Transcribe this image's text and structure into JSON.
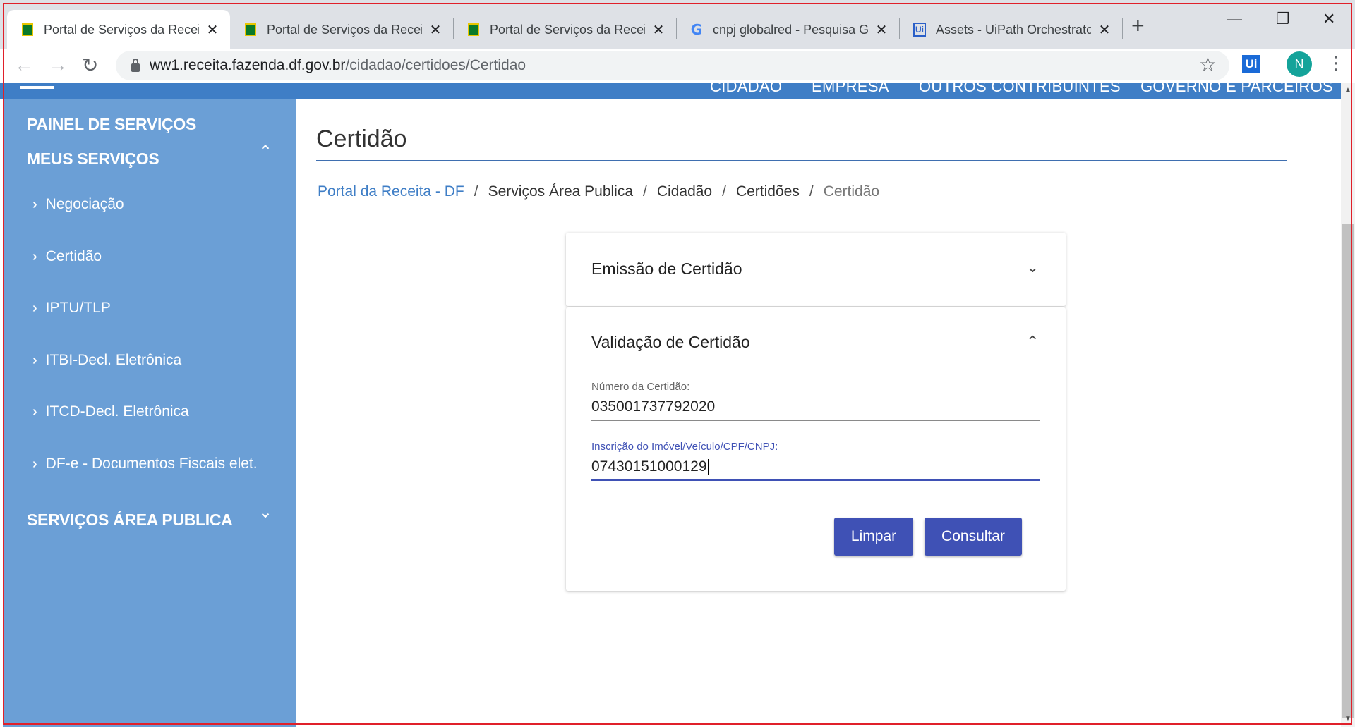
{
  "browser": {
    "tabs": [
      {
        "title": "Portal de Serviços da Receit",
        "favicon": "receita-flag-icon",
        "active": true
      },
      {
        "title": "Portal de Serviços da Receit",
        "favicon": "receita-flag-icon",
        "active": false
      },
      {
        "title": "Portal de Serviços da Receit",
        "favicon": "receita-flag-icon",
        "active": false
      },
      {
        "title": "cnpj globalred - Pesquisa G",
        "favicon": "google-icon",
        "active": false
      },
      {
        "title": "Assets - UiPath Orchestrato",
        "favicon": "uipath-icon",
        "active": false
      }
    ],
    "close_glyph": "✕",
    "new_tab_glyph": "+",
    "window": {
      "minimize": "—",
      "maximize": "❐",
      "close": "✕"
    },
    "nav": {
      "back": "←",
      "forward": "→",
      "reload": "↻"
    },
    "url_host": "ww1.receita.fazenda.df.gov.br",
    "url_path": "/cidadao/certidoes/Certidao",
    "bookmark_glyph": "☆",
    "extension_label": "Ui",
    "profile_initial": "N",
    "menu_glyph": "⋮"
  },
  "topnav": {
    "links": [
      "CIDADÃO",
      "EMPRESA",
      "OUTROS CONTRIBUINTES",
      "GOVERNO E PARCEIROS"
    ],
    "color": "#3f7ec6"
  },
  "sidebar": {
    "color": "#6b9fd6",
    "painel": "PAINEL DE SERVIÇOS",
    "meus_servicos": "MEUS SERVIÇOS",
    "meus_servicos_chevron": "⌃",
    "arrow": "›",
    "items": [
      "Negociação",
      "Certidão",
      "IPTU/TLP",
      "ITBI-Decl. Eletrônica",
      "ITCD-Decl. Eletrônica",
      "DF-e - Documentos Fiscais elet."
    ],
    "servicos_area_publica": "SERVIÇOS ÁREA PUBLICA",
    "servicos_chevron": "⌄"
  },
  "main": {
    "title": "Certidão",
    "breadcrumb": {
      "home": "Portal da Receita - DF",
      "separator": "/",
      "items": [
        "Serviços Área Publica",
        "Cidadão",
        "Certidões"
      ],
      "current": "Certidão"
    },
    "emissao": {
      "title": "Emissão de Certidão",
      "chevron": "⌄",
      "expanded": false
    },
    "validacao": {
      "title": "Validação de Certidão",
      "chevron": "⌃",
      "expanded": true,
      "numero_label": "Número da Certidão:",
      "numero_value": "035001737792020",
      "inscricao_label": "Inscrição do Imóvel/Veículo/CPF/CNPJ:",
      "inscricao_value": "07430151000129",
      "limpar": "Limpar",
      "consultar": "Consultar"
    },
    "accent": "#3f51b5"
  },
  "scrollbar": {
    "up": "▲",
    "down": "▼"
  }
}
